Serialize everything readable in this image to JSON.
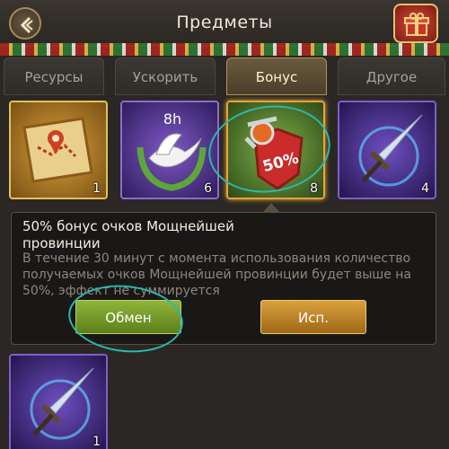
{
  "header": {
    "title": "Предметы",
    "back_icon": "back-arrow-icon",
    "gift_icon": "gift-box-icon"
  },
  "tabs": [
    {
      "label": "Ресурсы",
      "active": false
    },
    {
      "label": "Ускорить",
      "active": false
    },
    {
      "label": "Бонус",
      "active": true
    },
    {
      "label": "Другое",
      "active": false
    }
  ],
  "items": [
    {
      "name": "map-scroll",
      "count": "1",
      "icon": "map-scroll-icon",
      "selected": false
    },
    {
      "name": "peace-dove",
      "count": "6",
      "icon": "dove-icon",
      "badge": "8h",
      "selected": false
    },
    {
      "name": "power-bonus-50",
      "count": "8",
      "icon": "shield-50-percent-icon",
      "badge": "50%",
      "selected": true
    },
    {
      "name": "sword",
      "count": "4",
      "icon": "sword-icon",
      "selected": false
    },
    {
      "name": "sword-2",
      "count": "1",
      "icon": "sword-icon",
      "selected": false
    }
  ],
  "popup": {
    "title": "50% бонус очков Мощнейшей провинции",
    "description": "В течение 30 минут с момента использования количество получаемых очков Мощнейшей провинции будет выше на 50%, эффект не суммируется",
    "exchange_label": "Обмен",
    "use_label": "Исп."
  },
  "colors": {
    "accent_gold": "#b59353",
    "exchange_green": "#7da42d",
    "use_orange": "#c98a2a",
    "annotation_teal": "#2bb8ad"
  }
}
